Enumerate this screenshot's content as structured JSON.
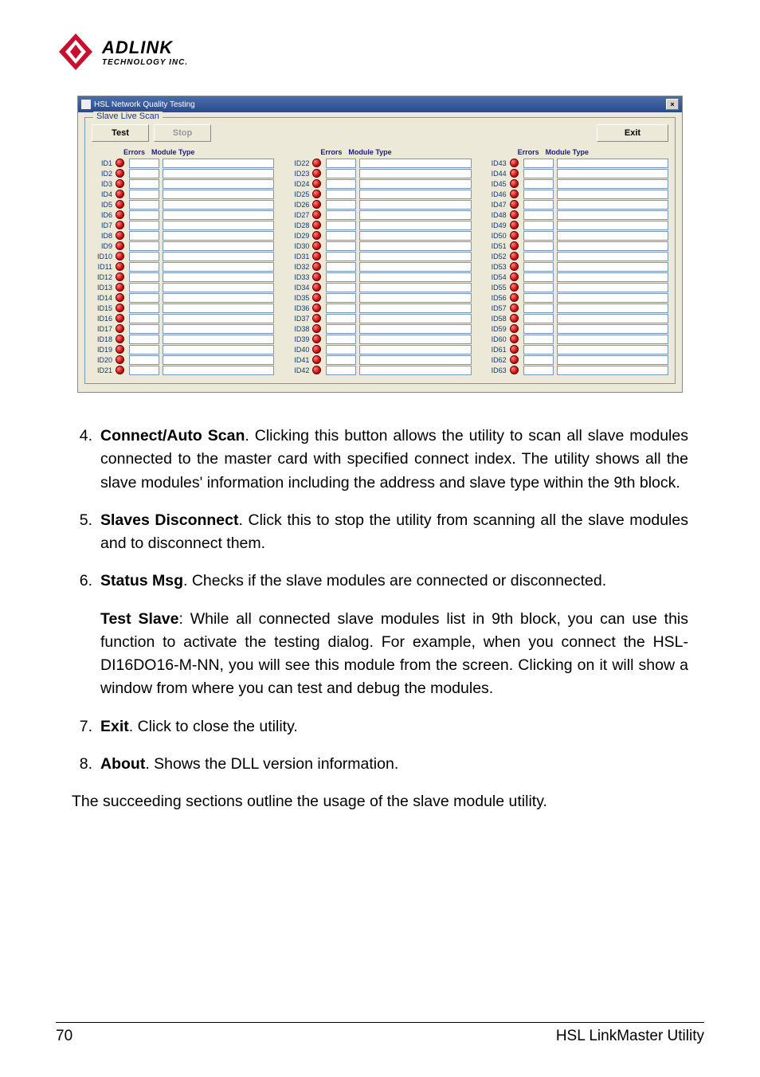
{
  "logo": {
    "name": "ADLINK",
    "sub": "TECHNOLOGY INC."
  },
  "window": {
    "title": "HSL Network Quality Testing",
    "close": "×",
    "group_label": "Slave Live Scan",
    "buttons": {
      "test": "Test",
      "stop": "Stop",
      "exit": "Exit"
    },
    "headers": {
      "errors": "Errors",
      "module_type": "Module Type"
    },
    "columns": [
      {
        "start": 1,
        "end": 21
      },
      {
        "start": 22,
        "end": 42
      },
      {
        "start": 43,
        "end": 63
      }
    ]
  },
  "items": [
    {
      "n": "4.",
      "b": "Connect/Auto Scan",
      "t": ". Clicking this button allows the utility to scan all slave modules connected to the master card with specified connect index. The utility shows all the slave modules' information including the address and slave type within the 9th block."
    },
    {
      "n": "5.",
      "b": "Slaves Disconnect",
      "t": ". Click this to stop the utility from scanning all the slave modules and to disconnect them."
    },
    {
      "n": "6.",
      "b": "Status Msg",
      "t": ". Checks if the slave modules are connected or disconnected."
    }
  ],
  "test_slave": {
    "b": "Test Slave",
    "t": ": While all connected slave modules list in 9th block, you can use this function to activate the testing dialog. For example, when you connect the HSL-DI16DO16-M-NN, you will see this module from the screen. Clicking on it will show a window from where you can test and debug the modules."
  },
  "items2": [
    {
      "n": "7.",
      "b": "Exit",
      "t": ". Click to close the utility."
    },
    {
      "n": "8.",
      "b": "About",
      "t": ". Shows the DLL version information."
    }
  ],
  "closing": "The succeeding sections outline the usage of the slave module utility.",
  "footer": {
    "page": "70",
    "title": "HSL LinkMaster Utility"
  }
}
